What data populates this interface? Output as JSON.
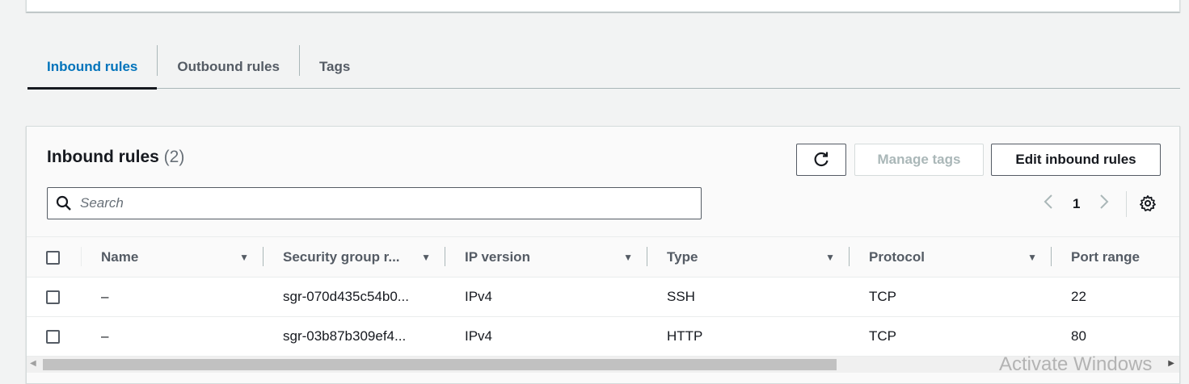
{
  "tabs": [
    {
      "label": "Inbound rules",
      "active": true
    },
    {
      "label": "Outbound rules",
      "active": false
    },
    {
      "label": "Tags",
      "active": false
    }
  ],
  "panel": {
    "title": "Inbound rules",
    "count": "(2)",
    "buttons": {
      "refresh_icon": "refresh-icon",
      "manage_tags": "Manage tags",
      "edit_inbound_rules": "Edit inbound rules"
    },
    "search": {
      "placeholder": "Search",
      "value": ""
    },
    "pagination": {
      "current_page": "1",
      "prev_icon": "chevron-left-icon",
      "next_icon": "chevron-right-icon"
    },
    "settings_icon": "gear-icon"
  },
  "table": {
    "columns": [
      "Name",
      "Security group r...",
      "IP version",
      "Type",
      "Protocol",
      "Port range"
    ],
    "rows": [
      {
        "name": "–",
        "sgr": "sgr-070d435c54b0...",
        "ip_version": "IPv4",
        "type": "SSH",
        "protocol": "TCP",
        "port_range": "22"
      },
      {
        "name": "–",
        "sgr": "sgr-03b87b309ef4...",
        "ip_version": "IPv4",
        "type": "HTTP",
        "protocol": "TCP",
        "port_range": "80"
      }
    ]
  },
  "watermark": "Activate Windows",
  "colors": {
    "accent": "#0073bb",
    "text": "#16191f",
    "muted": "#545b64",
    "background": "#f2f3f3"
  }
}
